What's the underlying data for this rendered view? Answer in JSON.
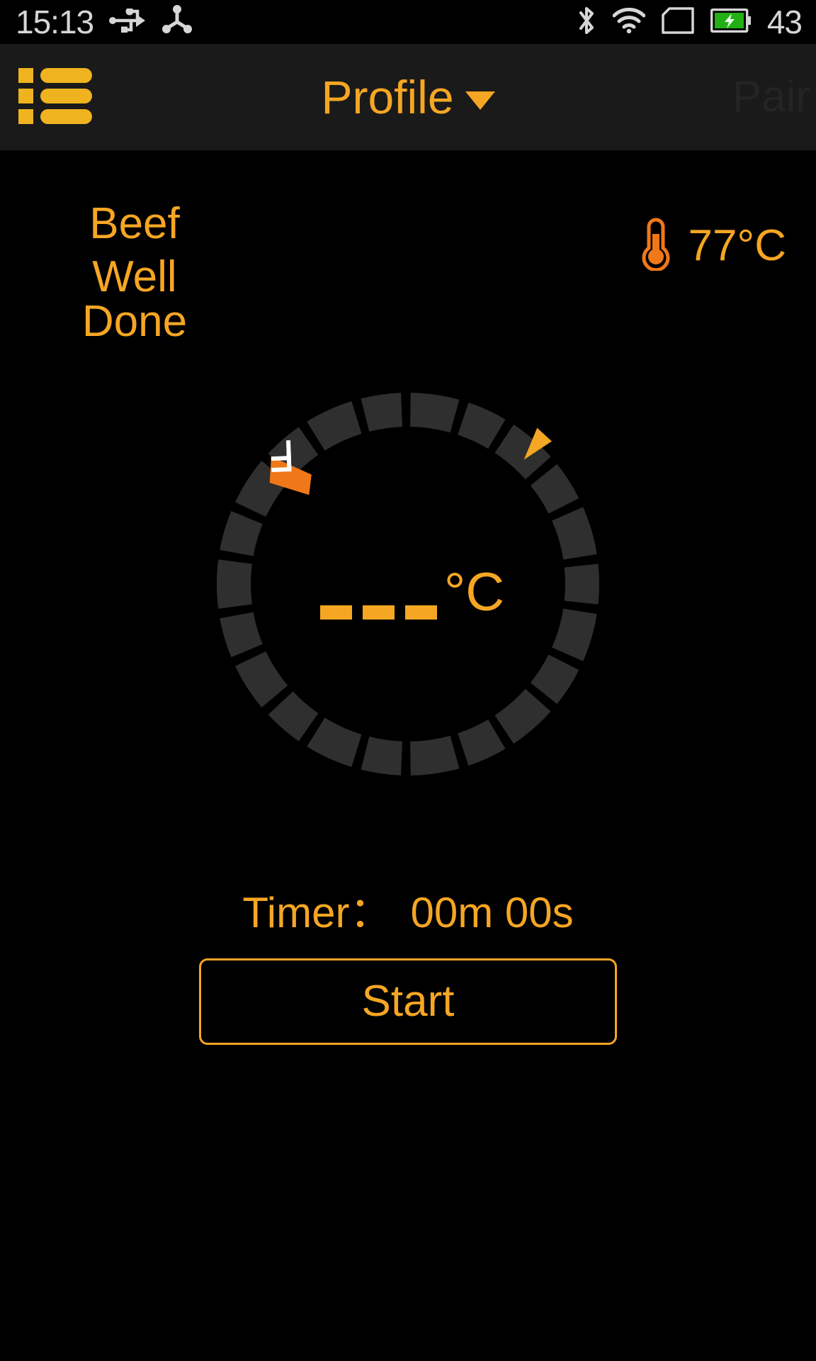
{
  "statusbar": {
    "time": "15:13",
    "battery_percent": "43",
    "icons": [
      {
        "name": "usb-icon"
      },
      {
        "name": "cast-icon"
      },
      {
        "name": "bluetooth-icon"
      },
      {
        "name": "wifi-icon"
      },
      {
        "name": "sim-card-icon"
      },
      {
        "name": "battery-charging-icon"
      }
    ],
    "colors": {
      "text": "#d6d6d6",
      "battery_fill": "#22b014"
    }
  },
  "header": {
    "menu_icon": "list-menu-icon",
    "title": "Profile",
    "dropdown_icon": "chevron-down-icon",
    "pair_label": "Pair",
    "background": "#1a1a1a",
    "accent": "#f5a623",
    "pair_disabled_color": "#242424"
  },
  "profile": {
    "meat_type": "Beef",
    "doneness": "Well Done",
    "target_temp": "77°C",
    "thermometer_icon": "thermometer-icon"
  },
  "gauge": {
    "center_reading": "- - -",
    "center_unit": "°C",
    "dash_count": 3,
    "target_marker_icon": "target-wedge-marker",
    "current_marker_icon": "current-pointer-marker",
    "ring_color": "#2f2f2f",
    "target_marker_color": "#f5a623",
    "current_marker_color": "#f07818",
    "segments_total": 22,
    "target_marker_angle_deg": 42,
    "current_marker_angle_deg": 313
  },
  "footer": {
    "timer_label": "Timer：",
    "timer_value": "00m 00s",
    "start_label": "Start"
  }
}
